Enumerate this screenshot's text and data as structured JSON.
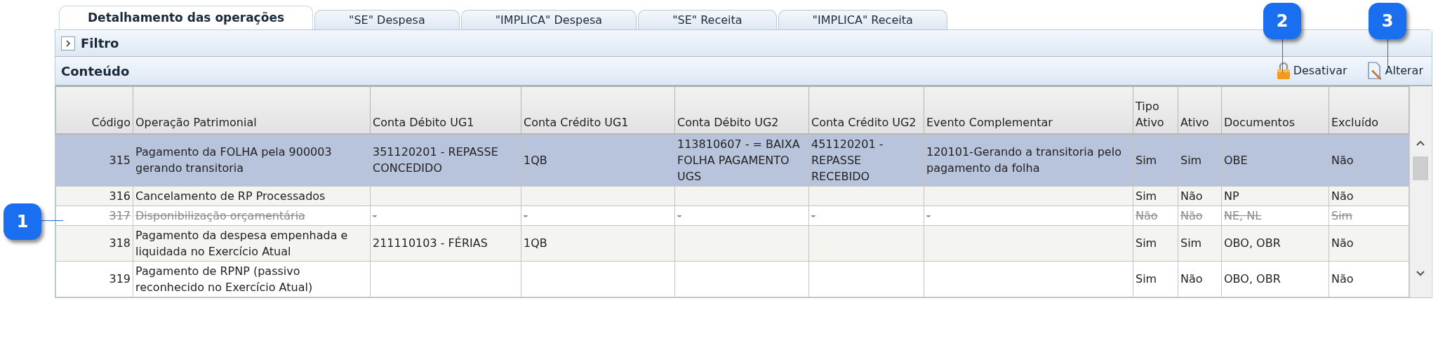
{
  "tabs": [
    {
      "label": "Detalhamento das operações",
      "selected": true
    },
    {
      "label": "\"SE\" Despesa",
      "selected": false
    },
    {
      "label": "\"IMPLICA\" Despesa",
      "selected": false
    },
    {
      "label": "\"SE\" Receita",
      "selected": false
    },
    {
      "label": "\"IMPLICA\" Receita",
      "selected": false
    }
  ],
  "filter": {
    "title": "Filtro",
    "expanded": false
  },
  "content": {
    "title": "Conteúdo",
    "actions": [
      {
        "kind": "lock",
        "label": "Desativar"
      },
      {
        "kind": "edit",
        "label": "Alterar"
      }
    ]
  },
  "table": {
    "columns": [
      "Código",
      "Operação Patrimonial",
      "Conta Débito UG1",
      "Conta Crédito UG1",
      "Conta Débito UG2",
      "Conta Crédito UG2",
      "Evento Complementar",
      "Tipo Ativo",
      "Ativo",
      "Documentos",
      "Excluído"
    ],
    "rows": [
      {
        "selected": true,
        "deleted": false,
        "cells": [
          "315",
          "Pagamento da FOLHA pela 900003 gerando transitoria",
          "351120201 - REPASSE CONCEDIDO",
          "1QB",
          "113810607 - = BAIXA FOLHA PAGAMENTO UGS",
          "451120201 - REPASSE RECEBIDO",
          "120101-Gerando a transitoria pelo pagamento da folha",
          "Sim",
          "Sim",
          "OBE",
          "Não"
        ]
      },
      {
        "selected": false,
        "deleted": false,
        "cells": [
          "316",
          "Cancelamento de RP Processados",
          "",
          "",
          "",
          "",
          "",
          "Sim",
          "Não",
          "NP",
          "Não"
        ]
      },
      {
        "selected": false,
        "deleted": true,
        "cells": [
          "317",
          "Disponibilização orçamentária",
          "-",
          "-",
          "-",
          "-",
          "-",
          "Não",
          "Não",
          "NE, NL",
          "Sim"
        ]
      },
      {
        "selected": false,
        "deleted": false,
        "cells": [
          "318",
          "Pagamento da despesa empenhada e liquidada no Exercício Atual",
          "211110103 - FÉRIAS",
          "1QB",
          "",
          "",
          "",
          "Sim",
          "Sim",
          "OBO, OBR",
          "Não"
        ]
      },
      {
        "selected": false,
        "deleted": false,
        "cells": [
          "319",
          "Pagamento de RPNP (passivo reconhecido no Exercício Atual)",
          "",
          "",
          "",
          "",
          "",
          "Sim",
          "Não",
          "OBO, OBR",
          "Não"
        ]
      }
    ]
  },
  "callouts": [
    {
      "number": "1"
    },
    {
      "number": "2"
    },
    {
      "number": "3"
    }
  ]
}
